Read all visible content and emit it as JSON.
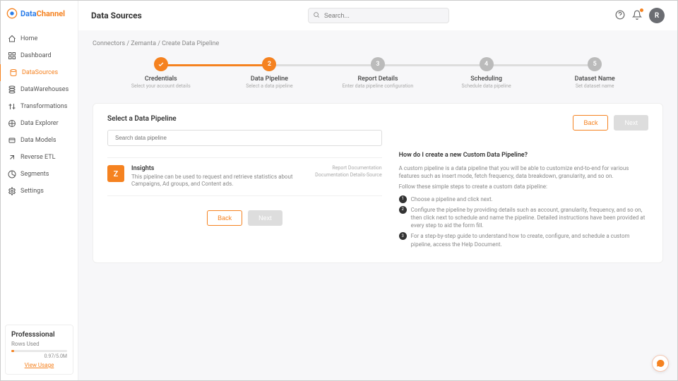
{
  "brand": {
    "name_a": "Data",
    "name_b": "Channel"
  },
  "nav": [
    {
      "id": "home",
      "label": "Home"
    },
    {
      "id": "dashboard",
      "label": "Dashboard"
    },
    {
      "id": "datasources",
      "label": "DataSources",
      "active": true
    },
    {
      "id": "datawarehouses",
      "label": "DataWarehouses"
    },
    {
      "id": "transformations",
      "label": "Transformations"
    },
    {
      "id": "data-explorer",
      "label": "Data Explorer"
    },
    {
      "id": "data-models",
      "label": "Data Models"
    },
    {
      "id": "reverse-etl",
      "label": "Reverse ETL"
    },
    {
      "id": "segments",
      "label": "Segments"
    },
    {
      "id": "settings",
      "label": "Settings"
    }
  ],
  "plan": {
    "title": "Professsional",
    "rows_label": "Rows Used",
    "usage": "0.97/5.0M",
    "view_usage": "View Usage"
  },
  "topbar": {
    "title": "Data Sources",
    "search_placeholder": "Search...",
    "avatar_initial": "R"
  },
  "breadcrumb": {
    "a": "Connectors",
    "b": "Zemanta",
    "c": "Create Data Pipeline"
  },
  "steps": [
    {
      "label": "Credentials",
      "sublabel": "Select your account details",
      "state": "done"
    },
    {
      "label": "Data Pipeline",
      "sublabel": "Select a data pipeline",
      "state": "active",
      "num": "2"
    },
    {
      "label": "Report Details",
      "sublabel": "Enter data pipeline configuration",
      "state": "pending",
      "num": "3"
    },
    {
      "label": "Scheduling",
      "sublabel": "Schedule data pipeline",
      "state": "pending",
      "num": "4"
    },
    {
      "label": "Dataset Name",
      "sublabel": "Set dataset name",
      "state": "pending",
      "num": "5"
    }
  ],
  "panel": {
    "section_title": "Select a Data Pipeline",
    "search_placeholder": "Search data pipeline",
    "pipeline": {
      "icon_letter": "Z",
      "name": "Insights",
      "desc": "This pipeline can be used to request and retrieve statistics about Campaigns, Ad groups, and Content ads.",
      "link1": "Report Documentation",
      "link2": "Documentation Details-Source"
    },
    "buttons": {
      "back": "Back",
      "next": "Next"
    },
    "help": {
      "title": "How do I create a new Custom Data Pipeline?",
      "intro1": "A custom pipeline is a data pipeline that you will be able to customize end-to-end for various features such as insert mode, fetch frequency, data breakdown, granularity, and so on.",
      "intro2": "Follow these simple steps to create a custom data pipeline:",
      "steps": [
        "Choose a pipeline and click next.",
        "Configure the pipeline by providing details such as account, granularity, frequency, and so on, then click next to schedule and name the pipeline. Detailed instructions have been provided at every step to aid the form fill.",
        "For a step-by-step guide to understand how to create, configure, and schedule a custom pipeline, access the Help Document."
      ]
    }
  }
}
